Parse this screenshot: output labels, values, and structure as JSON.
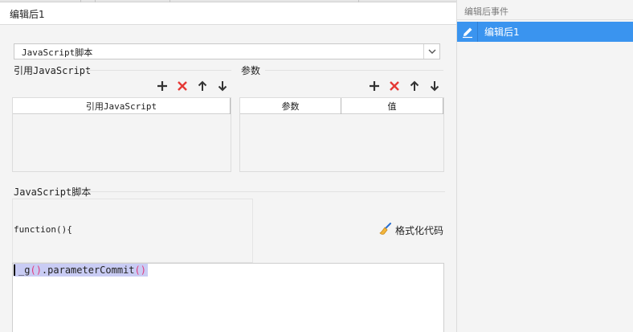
{
  "header": {
    "title": "编辑后1"
  },
  "script_select": {
    "value": "JavaScript脚本"
  },
  "ref_js": {
    "label": "引用JavaScript",
    "column": "引用JavaScript"
  },
  "params": {
    "label": "参数",
    "columns": [
      "参数",
      "值"
    ]
  },
  "script_section": {
    "label": "JavaScript脚本",
    "function_open": "function(){",
    "format_button": "格式化代码"
  },
  "editor": {
    "prefix": "_g",
    "open_paren": "(",
    "close_paren": ")",
    "middle": ".parameterCommit",
    "call_open": "(",
    "call_close": ")"
  },
  "sidebar": {
    "title": "编辑后事件",
    "items": [
      {
        "label": "编辑后1"
      }
    ]
  },
  "colors": {
    "accent": "#3a94ef",
    "delete": "#e53935",
    "selection": "#c9ccf4",
    "paren": "#e03a7e"
  }
}
